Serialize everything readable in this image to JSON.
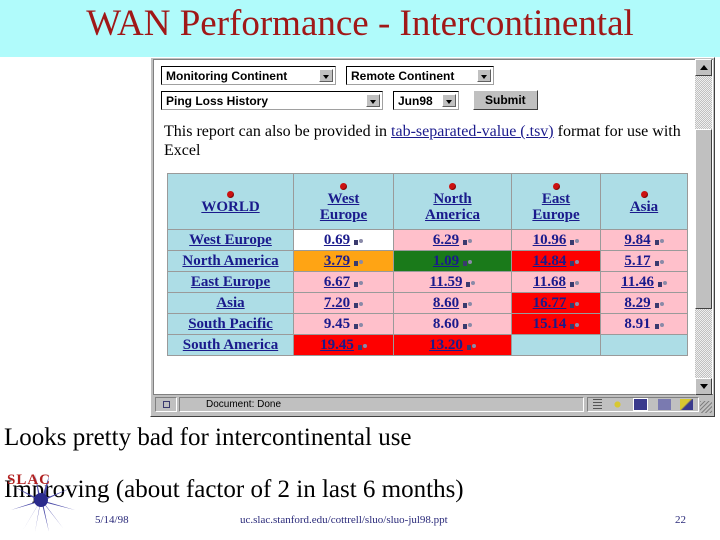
{
  "slide": {
    "title": "WAN Performance - Intercontinental",
    "title_color": "#a01818",
    "title_band_color": "#b0fbfb"
  },
  "browser": {
    "form": {
      "monitoring_continent": "Monitoring Continent",
      "remote_continent": "Remote Continent",
      "report_type": "Ping Loss History",
      "month": "Jun98",
      "submit_label": "Submit"
    },
    "paragraph": {
      "before_link": "This report can also be provided in ",
      "link": "tab-separated-value (.tsv)",
      "after_link": " format for use with Excel"
    },
    "table": {
      "corner_label": "WORLD",
      "columns": [
        "West Europe",
        "North America",
        "East Europe",
        "Asia"
      ],
      "rows": [
        {
          "label": "West Europe",
          "cells": [
            {
              "value": "0.69",
              "color": "#ffffff",
              "linked": true
            },
            {
              "value": "6.29",
              "color": "#ffc0cb",
              "linked": true
            },
            {
              "value": "10.96",
              "color": "#ffc0cb",
              "linked": true
            },
            {
              "value": "9.84",
              "color": "#ffc0cb",
              "linked": true
            }
          ]
        },
        {
          "label": "North America",
          "cells": [
            {
              "value": "3.79",
              "color": "#ffa414",
              "linked": true
            },
            {
              "value": "1.09",
              "color": "#1a7a1a",
              "linked": true
            },
            {
              "value": "14.84",
              "color": "#fe0000",
              "linked": true
            },
            {
              "value": "5.17",
              "color": "#ffc0cb",
              "linked": true
            }
          ]
        },
        {
          "label": "East Europe",
          "cells": [
            {
              "value": "6.67",
              "color": "#ffc0cb",
              "linked": true
            },
            {
              "value": "11.59",
              "color": "#ffc0cb",
              "linked": true
            },
            {
              "value": "11.68",
              "color": "#ffc0cb",
              "linked": true
            },
            {
              "value": "11.46",
              "color": "#ffc0cb",
              "linked": true
            }
          ]
        },
        {
          "label": "Asia",
          "cells": [
            {
              "value": "7.20",
              "color": "#ffc0cb",
              "linked": true
            },
            {
              "value": "8.60",
              "color": "#ffc0cb",
              "linked": true
            },
            {
              "value": "16.77",
              "color": "#fe0000",
              "linked": true
            },
            {
              "value": "8.29",
              "color": "#ffc0cb",
              "linked": true
            }
          ]
        },
        {
          "label": "South Pacific",
          "cells": [
            {
              "value": "9.45",
              "color": "#ffc0cb",
              "linked": false
            },
            {
              "value": "8.60",
              "color": "#ffc0cb",
              "linked": false
            },
            {
              "value": "15.14",
              "color": "#fe0000",
              "linked": false
            },
            {
              "value": "8.91",
              "color": "#ffc0cb",
              "linked": false
            }
          ]
        },
        {
          "label": "South America",
          "cells": [
            {
              "value": "19.45",
              "color": "#fe0000",
              "linked": true
            },
            {
              "value": "13.20",
              "color": "#fe0000",
              "linked": true
            },
            {
              "value": "",
              "color": "#addde6",
              "linked": false
            },
            {
              "value": "",
              "color": "#addde6",
              "linked": false
            }
          ]
        }
      ]
    },
    "statusbar": {
      "text": "Document: Done"
    }
  },
  "bullets": [
    "Looks pretty bad for intercontinental use",
    "Improving (about factor of 2 in last 6 months)"
  ],
  "logo": {
    "wordmark": "SLAC"
  },
  "footer": {
    "date": "5/14/98",
    "url": "uc.slac.stanford.edu/cottrell/sluo/sluo-jul98.ppt",
    "page": "22"
  }
}
